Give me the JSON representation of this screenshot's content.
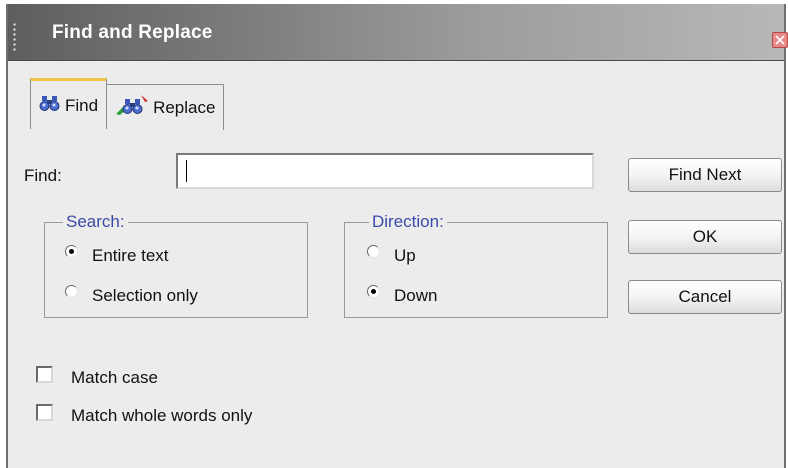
{
  "window": {
    "title": "Find and Replace"
  },
  "tabs": [
    {
      "label": "Find",
      "icon": "binoculars-icon",
      "active": true
    },
    {
      "label": "Replace",
      "icon": "binoculars-replace-icon",
      "active": false
    }
  ],
  "find": {
    "label": "Find:",
    "value": ""
  },
  "search_group": {
    "legend": "Search:",
    "options": [
      {
        "label": "Entire text",
        "checked": true
      },
      {
        "label": "Selection only",
        "checked": false
      }
    ]
  },
  "direction_group": {
    "legend": "Direction:",
    "options": [
      {
        "label": "Up",
        "checked": false
      },
      {
        "label": "Down",
        "checked": true
      }
    ]
  },
  "options": {
    "match_case": {
      "label": "Match case",
      "checked": false
    },
    "match_whole_words": {
      "label": "Match whole words only",
      "checked": false
    }
  },
  "buttons": {
    "find_next": "Find Next",
    "ok": "OK",
    "cancel": "Cancel"
  },
  "colors": {
    "titlebar_start": "#5e5e5e",
    "titlebar_end": "#b8b8b8",
    "legend_text": "#3a4aa8",
    "active_tab_accent": "#f0c24a",
    "close_button": "#e88888"
  }
}
